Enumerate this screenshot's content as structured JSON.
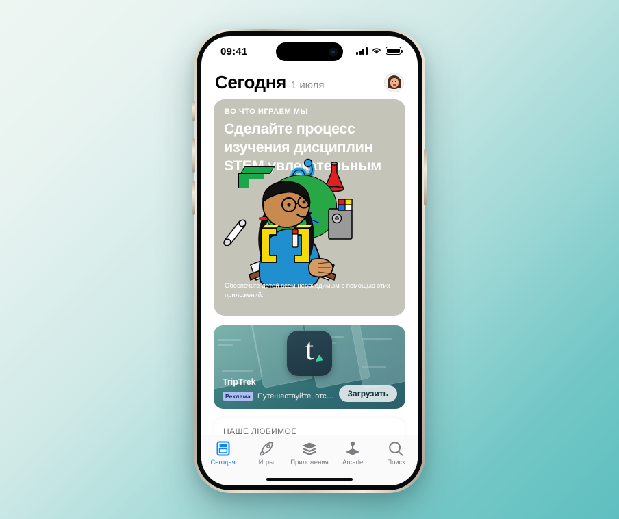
{
  "background": {
    "gradient_from": "#eef6f2",
    "gradient_to": "#5fbfc0"
  },
  "device": {
    "frame_color": "#d5cec2",
    "bezel_color": "#07090a"
  },
  "status_bar": {
    "time": "09:41",
    "cellular_icon": "cellular-bars-icon",
    "wifi_icon": "wifi-icon",
    "battery_icon": "battery-full-icon"
  },
  "header": {
    "title": "Сегодня",
    "date": "1 июля",
    "avatar_icon": "memoji-avatar"
  },
  "feature_card": {
    "eyebrow": "ВО ЧТО ИГРАЕМ МЫ",
    "headline": "Сделайте процесс изучения дисциплин STEM увлекательным",
    "caption": "Обеспечьте детей всем необходимым с помощью этих приложений.",
    "background_color": "#c5c4b8",
    "text_color": "#ffffff"
  },
  "ad_card": {
    "app_name": "TripTrek",
    "badge": "Реклама",
    "description": "Путешествуйте, отсле...",
    "get_button": "Загрузить",
    "icon_letter": "t",
    "icon_accent": "#3ad0a5",
    "background_color": "#3e7f80"
  },
  "peek_section": {
    "title": "НАШЕ ЛЮБИМОЕ"
  },
  "tabbar": {
    "accent_color": "#0a84ff",
    "items": [
      {
        "label": "Сегодня",
        "icon": "today-card-icon",
        "active": true
      },
      {
        "label": "Игры",
        "icon": "rocket-icon",
        "active": false
      },
      {
        "label": "Приложения",
        "icon": "stack-layers-icon",
        "active": false
      },
      {
        "label": "Arcade",
        "icon": "joystick-icon",
        "active": false
      },
      {
        "label": "Поиск",
        "icon": "search-icon",
        "active": false
      }
    ]
  }
}
